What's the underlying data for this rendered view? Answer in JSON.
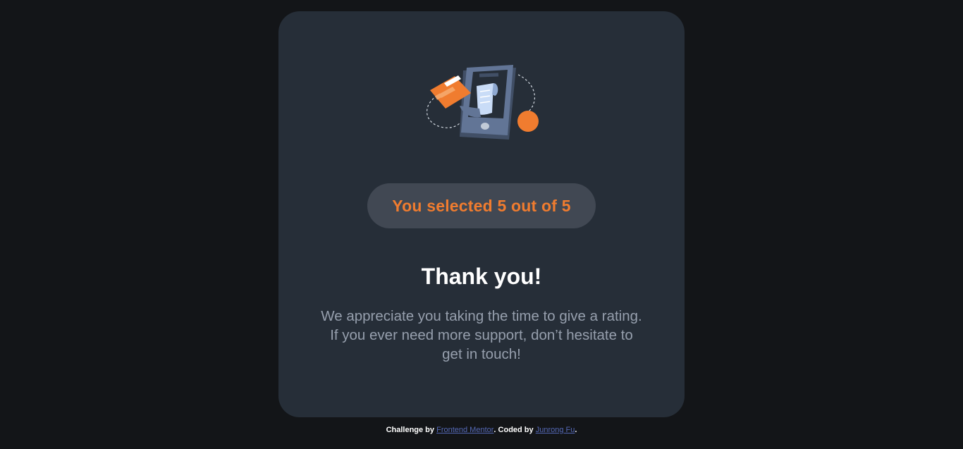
{
  "card": {
    "illustration_icon": "phone-receipt-card-illustration",
    "selection_text": "You selected 5 out of 5",
    "title": "Thank you!",
    "body_lines": [
      "We appreciate you taking the time to give a rating.",
      "If you ever need more support, don’t hesitate to",
      "get in touch!"
    ]
  },
  "footer": {
    "challenge_prefix": "Challenge by ",
    "challenge_link": "Frontend Mentor",
    "coded_prefix": ". Coded by ",
    "author_link": "Junrong Fu",
    "suffix": "."
  },
  "colors": {
    "background": "#131518",
    "card": "#262e38",
    "pill": "#414853",
    "accent": "#f07c2f",
    "muted_text": "#969fad",
    "link": "#5468b5"
  }
}
